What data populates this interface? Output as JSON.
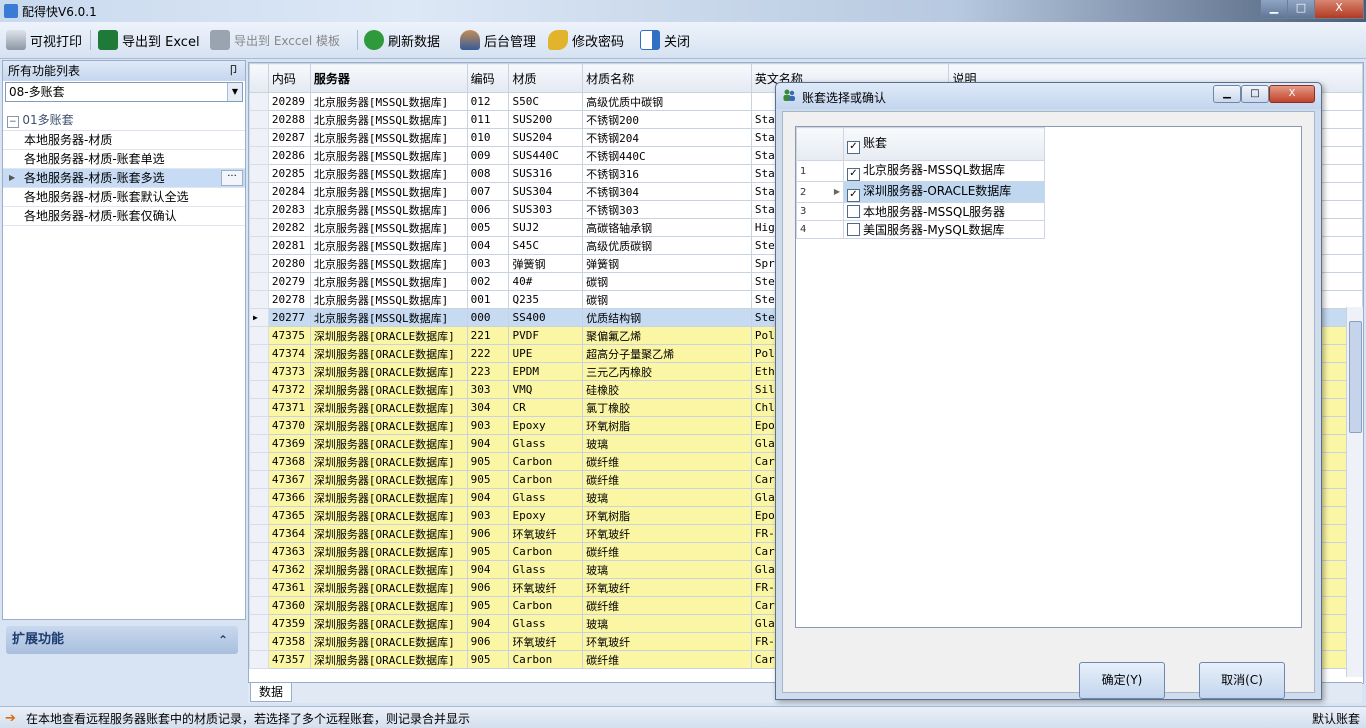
{
  "window": {
    "title": "配得快V6.0.1",
    "min": "▁",
    "max": "□",
    "close": "X"
  },
  "toolbar": {
    "print": "可视打印",
    "export_excel": "导出到 Excel",
    "export_template": "导出到 Exccel 模板",
    "refresh": "刷新数据",
    "admin": "后台管理",
    "password": "修改密码",
    "close": "关闭"
  },
  "left": {
    "header": "所有功能列表",
    "pin": "卩",
    "combo_value": "08-多账套",
    "group": "01多账套",
    "items": [
      "本地服务器-材质",
      "各地服务器-材质-账套单选",
      "各地服务器-材质-账套多选",
      "各地服务器-材质-账套默认全选",
      "各地服务器-材质-账套仅确认"
    ],
    "more": "···",
    "ext_title": "扩展功能",
    "ext_chevron": "⌃"
  },
  "grid": {
    "headers": [
      "内码",
      "服务器",
      "编码",
      "材质",
      "材质名称",
      "英文名称",
      "说明"
    ],
    "rows": [
      [
        "20289",
        "北京服务器[MSSQL数据库]",
        "012",
        "S50C",
        "高级优质中碳钢",
        ""
      ],
      [
        "20288",
        "北京服务器[MSSQL数据库]",
        "011",
        "SUS200",
        "不锈钢200",
        "Sta"
      ],
      [
        "20287",
        "北京服务器[MSSQL数据库]",
        "010",
        "SUS204",
        "不锈钢204",
        "Sta"
      ],
      [
        "20286",
        "北京服务器[MSSQL数据库]",
        "009",
        "SUS440C",
        "不锈钢440C",
        "Sta"
      ],
      [
        "20285",
        "北京服务器[MSSQL数据库]",
        "008",
        "SUS316",
        "不锈钢316",
        "Sta"
      ],
      [
        "20284",
        "北京服务器[MSSQL数据库]",
        "007",
        "SUS304",
        "不锈钢304",
        "Sta"
      ],
      [
        "20283",
        "北京服务器[MSSQL数据库]",
        "006",
        "SUS303",
        "不锈钢303",
        "Sta"
      ],
      [
        "20282",
        "北京服务器[MSSQL数据库]",
        "005",
        "SUJ2",
        "高碳铬轴承钢",
        "Hig"
      ],
      [
        "20281",
        "北京服务器[MSSQL数据库]",
        "004",
        "S45C",
        "高级优质碳钢",
        "Ste"
      ],
      [
        "20280",
        "北京服务器[MSSQL数据库]",
        "003",
        "弹簧钢",
        "弹簧钢",
        "Spr"
      ],
      [
        "20279",
        "北京服务器[MSSQL数据库]",
        "002",
        "40#",
        "碳钢",
        "Ste"
      ],
      [
        "20278",
        "北京服务器[MSSQL数据库]",
        "001",
        "Q235",
        "碳钢",
        "Ste"
      ],
      [
        "20277",
        "北京服务器[MSSQL数据库]",
        "000",
        "SS400",
        "优质结构钢",
        "Ste"
      ],
      [
        "47375",
        "深圳服务器[ORACLE数据库]",
        "221",
        "PVDF",
        "聚偏氟乙烯",
        "Pol"
      ],
      [
        "47374",
        "深圳服务器[ORACLE数据库]",
        "222",
        "UPE",
        "超高分子量聚乙烯",
        "Pol"
      ],
      [
        "47373",
        "深圳服务器[ORACLE数据库]",
        "223",
        "EPDM",
        "三元乙丙橡胶",
        "Eth"
      ],
      [
        "47372",
        "深圳服务器[ORACLE数据库]",
        "303",
        "VMQ",
        "硅橡胶",
        "Sil"
      ],
      [
        "47371",
        "深圳服务器[ORACLE数据库]",
        "304",
        "CR",
        "氯丁橡胶",
        "Chl"
      ],
      [
        "47370",
        "深圳服务器[ORACLE数据库]",
        "903",
        "Epoxy",
        "环氧树脂",
        "Epo"
      ],
      [
        "47369",
        "深圳服务器[ORACLE数据库]",
        "904",
        "Glass",
        "玻璃",
        "Gla"
      ],
      [
        "47368",
        "深圳服务器[ORACLE数据库]",
        "905",
        "Carbon",
        "碳纤维",
        "Car"
      ],
      [
        "47367",
        "深圳服务器[ORACLE数据库]",
        "905",
        "Carbon",
        "碳纤维",
        "Car"
      ],
      [
        "47366",
        "深圳服务器[ORACLE数据库]",
        "904",
        "Glass",
        "玻璃",
        "Gla"
      ],
      [
        "47365",
        "深圳服务器[ORACLE数据库]",
        "903",
        "Epoxy",
        "环氧树脂",
        "Epo"
      ],
      [
        "47364",
        "深圳服务器[ORACLE数据库]",
        "906",
        "环氧玻纤",
        "环氧玻纤",
        "FR-"
      ],
      [
        "47363",
        "深圳服务器[ORACLE数据库]",
        "905",
        "Carbon",
        "碳纤维",
        "Car"
      ],
      [
        "47362",
        "深圳服务器[ORACLE数据库]",
        "904",
        "Glass",
        "玻璃",
        "Gla"
      ],
      [
        "47361",
        "深圳服务器[ORACLE数据库]",
        "906",
        "环氧玻纤",
        "环氧玻纤",
        "FR-"
      ],
      [
        "47360",
        "深圳服务器[ORACLE数据库]",
        "905",
        "Carbon",
        "碳纤维",
        "Car"
      ],
      [
        "47359",
        "深圳服务器[ORACLE数据库]",
        "904",
        "Glass",
        "玻璃",
        "Gla"
      ],
      [
        "47358",
        "深圳服务器[ORACLE数据库]",
        "906",
        "环氧玻纤",
        "环氧玻纤",
        "FR-"
      ],
      [
        "47357",
        "深圳服务器[ORACLE数据库]",
        "905",
        "Carbon",
        "碳纤维",
        "Car"
      ]
    ],
    "current_row": 12,
    "yellow_from": 13,
    "tab": "数据"
  },
  "dialog": {
    "title": "账套选择或确认",
    "header": "账套",
    "rows": [
      {
        "n": "1",
        "label": "北京服务器-MSSQL数据库",
        "checked": true
      },
      {
        "n": "2",
        "label": "深圳服务器-ORACLE数据库",
        "checked": true
      },
      {
        "n": "3",
        "label": "本地服务器-MSSQL服务器",
        "checked": false
      },
      {
        "n": "4",
        "label": "美国服务器-MySQL数据库",
        "checked": false
      }
    ],
    "ok": "确定(Y)",
    "cancel": "取消(C)"
  },
  "status": {
    "text": "在本地查看远程服务器账套中的材质记录，若选择了多个远程账套，则记录合并显示",
    "right": "默认账套"
  },
  "colors": {
    "yellow_row": "#fbf6a4",
    "selected": "#c6daf2"
  }
}
